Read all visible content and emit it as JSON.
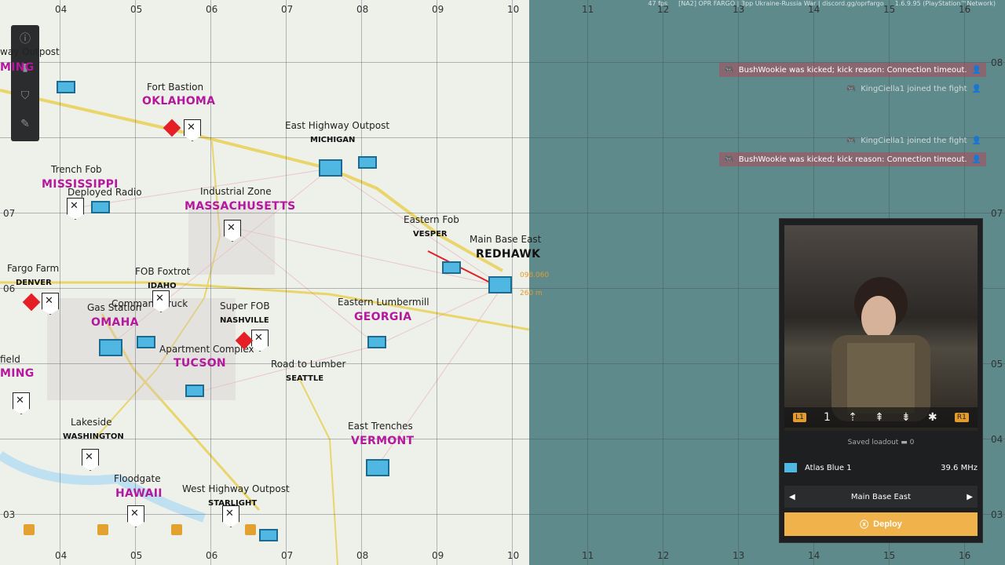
{
  "topbar": {
    "fps": "47 fps",
    "server": "[NA2] OPR FARGO | 3pp Ukraine-Russia War | discord.gg/oprfargo",
    "version": "1.6.9.95 (PlayStation™Network)"
  },
  "grid": {
    "columns": [
      "04",
      "05",
      "06",
      "07",
      "08",
      "09",
      "10",
      "11",
      "12",
      "13",
      "14",
      "15",
      "16"
    ],
    "rows": [
      "08",
      "07",
      "06",
      "05",
      "04",
      "03"
    ]
  },
  "map_labels": [
    {
      "id": "fort-bastion",
      "name": "Fort Bastion",
      "objective": "OKLAHOMA"
    },
    {
      "id": "east-highway",
      "name": "East Highway Outpost",
      "objective": "MICHIGAN"
    },
    {
      "id": "trench-fob",
      "name": "Trench Fob",
      "objective": "MISSISSIPPI"
    },
    {
      "id": "deployed-radio",
      "name": "Deployed Radio",
      "objective": ""
    },
    {
      "id": "industrial-zone",
      "name": "Industrial Zone",
      "objective": "MASSACHUSETTS"
    },
    {
      "id": "eastern-fob",
      "name": "Eastern Fob",
      "objective": "VESPER"
    },
    {
      "id": "main-base-east",
      "name": "Main Base East",
      "objective": "REDHAWK"
    },
    {
      "id": "fargo-farm",
      "name": "Fargo Farm",
      "objective": "DENVER"
    },
    {
      "id": "fob-foxtrot",
      "name": "FOB Foxtrot",
      "objective": "IDAHO"
    },
    {
      "id": "gas-station",
      "name": "Gas Station",
      "objective": "OMAHA"
    },
    {
      "id": "super-fob",
      "name": "Super FOB",
      "objective": "NASHVILLE"
    },
    {
      "id": "eastern-lumbermill",
      "name": "Eastern Lumbermill",
      "objective": "GEORGIA"
    },
    {
      "id": "apartment-complex",
      "name": "Apartment Complex",
      "objective": "TUCSON"
    },
    {
      "id": "road-to-lumber",
      "name": "Road to Lumber",
      "objective": "SEATTLE"
    },
    {
      "id": "lakeside",
      "name": "Lakeside",
      "objective": "WASHINGTON"
    },
    {
      "id": "east-trenches",
      "name": "East Trenches",
      "objective": "VERMONT"
    },
    {
      "id": "floodgate",
      "name": "Floodgate",
      "objective": "HAWAII"
    },
    {
      "id": "west-highway",
      "name": "West Highway Outpost",
      "objective": "STARLIGHT"
    }
  ],
  "edge_labels": {
    "way_outpost": "way Outpost",
    "ming": "MING",
    "field": "field",
    "command": "Command Truck"
  },
  "distance": {
    "bearing": "098.060",
    "range": "260 m"
  },
  "chat": [
    {
      "type": "kick",
      "text": "BushWookie was kicked; kick reason: Connection timeout."
    },
    {
      "type": "join",
      "text": "KingCiella1 joined the fight"
    },
    {
      "type": "join",
      "text": "KingCiella1 joined the fight"
    },
    {
      "type": "kick",
      "text": "BushWookie was kicked; kick reason: Connection timeout."
    }
  ],
  "panel": {
    "roles": [
      "L1",
      "1",
      "⇡",
      "⇞",
      "⇟",
      "✱",
      "R1"
    ],
    "saved_loadout": "Saved loadout",
    "saved_count": "0",
    "squad": "Atlas Blue 1",
    "frequency": "39.6 MHz",
    "spawn_point": "Main Base East",
    "deploy": "Deploy"
  },
  "colors": {
    "friendly": "#4fb7e1",
    "objective": "#b5179e",
    "enemy": "#e41f26",
    "deploy": "#f0b24a",
    "sea": "#5f8a8b"
  }
}
